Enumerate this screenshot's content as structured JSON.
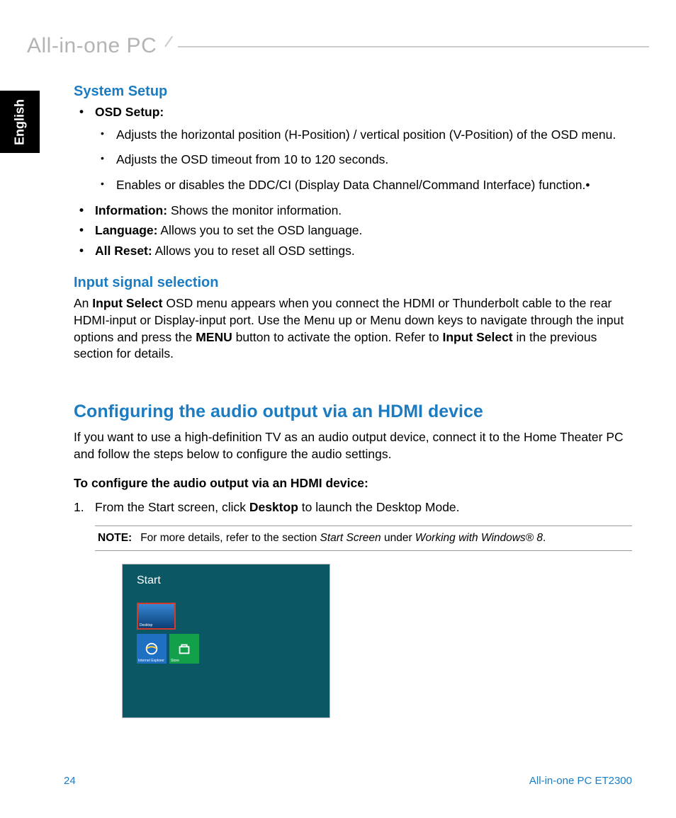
{
  "header": {
    "title": "All-in-one PC"
  },
  "langTab": "English",
  "section1": {
    "heading": "System Setup",
    "osd": {
      "label": "OSD Setup:",
      "items": [
        "Adjusts the horizontal position (H-Position) / vertical position (V-Position) of the OSD menu.",
        "Adjusts the OSD timeout from 10 to 120 seconds.",
        "Enables or disables the DDC/CI (Display Data Channel/Command Interface) function.•"
      ]
    },
    "info": {
      "label": "Information:",
      "text": " Shows the monitor information."
    },
    "language": {
      "label": "Language:",
      "text": " Allows you to set the OSD language."
    },
    "reset": {
      "label": "All Reset:",
      "text": " Allows you to reset all OSD settings."
    }
  },
  "section2": {
    "heading": "Input signal selection",
    "p1a": "An ",
    "p1b": "Input Select",
    "p1c": " OSD menu appears when you connect the HDMI or Thunderbolt cable to the rear HDMI-input or Display-input port. Use the Menu up or Menu down keys to navigate through the input options and press the ",
    "p1d": "MENU",
    "p1e": " button to activate the option. Refer to ",
    "p1f": "Input Select",
    "p1g": " in the previous section for details."
  },
  "section3": {
    "heading": "Configuring the audio output via an HDMI device",
    "intro": "If you want to use a high-definition TV as an audio output device, connect it to the Home Theater PC and follow the steps below to configure the audio settings.",
    "subhead": "To configure the audio output via an HDMI device:",
    "step1": {
      "num": "1.",
      "a": "From the Start screen, click ",
      "b": "Desktop",
      "c": " to launch the Desktop Mode."
    },
    "note": {
      "label": "NOTE:",
      "a": "For more details, refer to the section ",
      "i1": "Start Screen",
      "b": " under ",
      "i2": "Working with Windows® 8",
      "c": "."
    }
  },
  "screenshot": {
    "start": "Start",
    "tiles": {
      "desktop": "Desktop",
      "ie": "Internet Explorer",
      "store": "Store"
    }
  },
  "footer": {
    "page": "24",
    "model": "All-in-one PC ET2300"
  }
}
